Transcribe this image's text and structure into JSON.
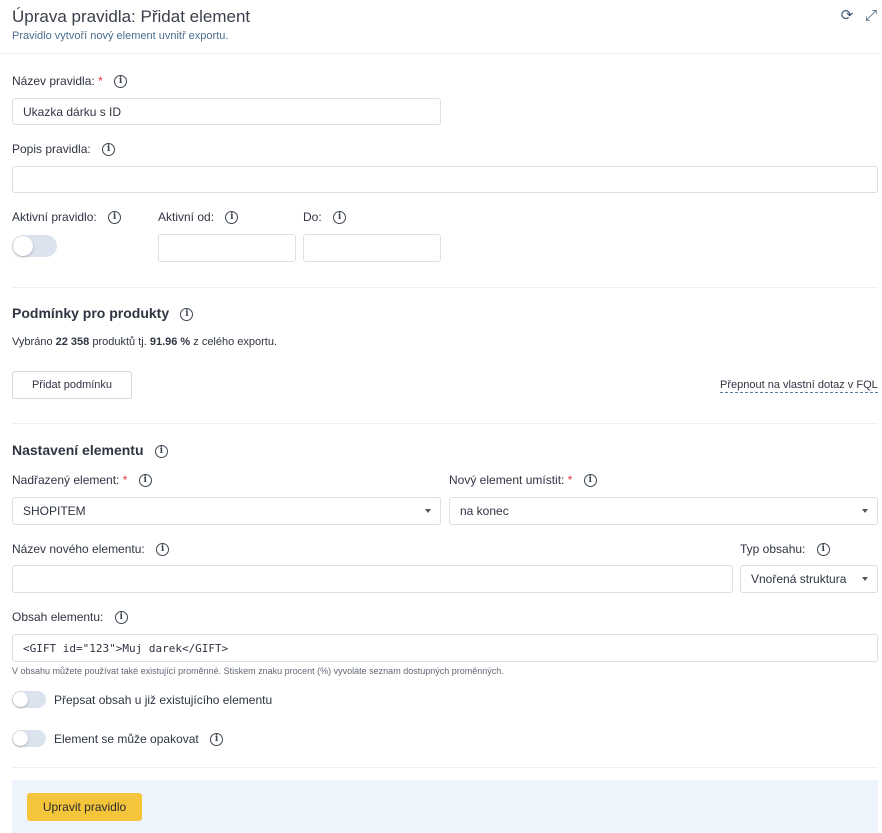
{
  "header": {
    "title": "Úprava pravidla: Přidat element",
    "subtitle": "Pravidlo vytvoří nový element uvnitř exportu."
  },
  "rule_name": {
    "label": "Název pravidla:",
    "required_mark": "*",
    "value": "Ukazka dárku s ID"
  },
  "rule_description": {
    "label": "Popis pravidla:",
    "value": ""
  },
  "active_rule": {
    "label": "Aktivní pravidlo:",
    "enabled": false
  },
  "active_from": {
    "label": "Aktivní od:",
    "value": ""
  },
  "active_to": {
    "label": "Do:",
    "value": ""
  },
  "conditions": {
    "title": "Podmínky pro produkty",
    "selected_prefix": "Vybráno ",
    "selected_count": "22 358",
    "selected_middle": " produktů tj. ",
    "selected_percent": "91.96 %",
    "selected_suffix": " z celého exportu.",
    "add_button": "Přidat podmínku",
    "fql_link": "Přepnout na vlastní dotaz v FQL"
  },
  "element_settings": {
    "title": "Nastavení elementu",
    "parent": {
      "label": "Nadřazený element:",
      "required_mark": "*",
      "value": "SHOPITEM"
    },
    "placement": {
      "label": "Nový element umístit:",
      "required_mark": "*",
      "value": "na konec"
    },
    "new_name": {
      "label": "Název nového elementu:",
      "value": ""
    },
    "content_type": {
      "label": "Typ obsahu:",
      "value": "Vnořená struktura"
    },
    "content": {
      "label": "Obsah elementu:",
      "value": "<GIFT id=\"123\">Muj darek</GIFT>",
      "hint": "V obsahu můžete používat také existující proměnné. Stiskem znaku procent (%) vyvoláte seznam dostupných proměnných."
    },
    "overwrite": {
      "label": "Přepsat obsah u již existujícího elementu",
      "enabled": false
    },
    "repeat": {
      "label": "Element se může opakovat",
      "enabled": false
    }
  },
  "footer": {
    "submit_label": "Upravit pravidlo"
  },
  "icons": {
    "info": "i",
    "refresh": "⟳",
    "expand": "⤢"
  },
  "colors": {
    "accent_button": "#f4c43a",
    "footer_bg": "#eef4fc",
    "required": "#e0383e"
  }
}
